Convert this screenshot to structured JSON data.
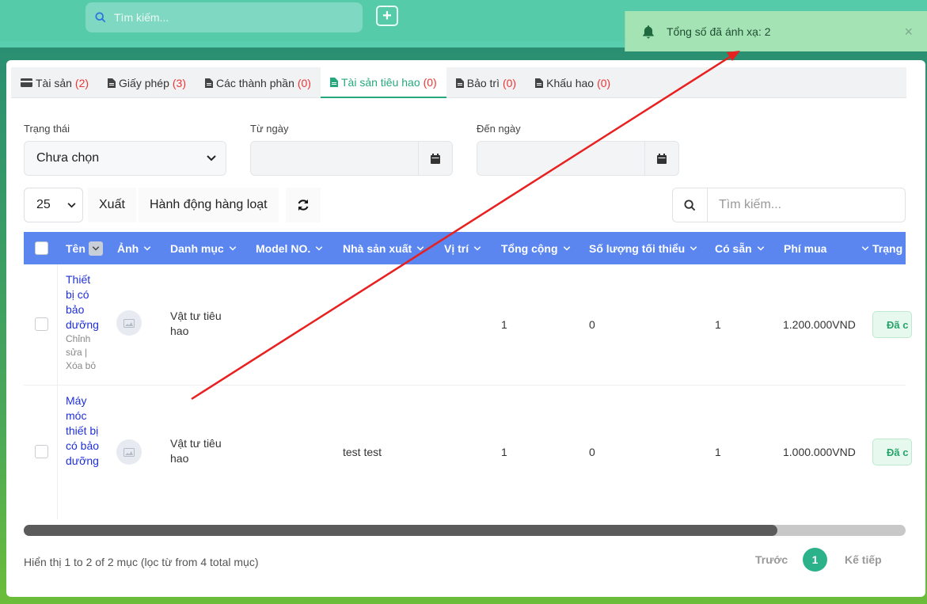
{
  "topbar": {
    "search_placeholder": "Tìm kiếm...",
    "add_label": "+"
  },
  "toast": {
    "message": "Tổng số đã ánh xạ: 2",
    "close": "×"
  },
  "tabs": [
    {
      "label": "Tài sản",
      "count": "(2)"
    },
    {
      "label": "Giấy phép",
      "count": "(3)"
    },
    {
      "label": "Các thành phần",
      "count": "(0)"
    },
    {
      "label": "Tài sản tiêu hao",
      "count": "(0)"
    },
    {
      "label": "Bảo trì",
      "count": "(0)"
    },
    {
      "label": "Khấu hao",
      "count": "(0)"
    }
  ],
  "filters": {
    "status_label": "Trạng thái",
    "status_value": "Chưa chọn",
    "from_label": "Từ ngày",
    "to_label": "Đến ngày"
  },
  "toolbar": {
    "page_size": "25",
    "export": "Xuất",
    "bulk": "Hành động hàng loạt",
    "search_placeholder": "Tìm kiếm..."
  },
  "columns": [
    "Tên",
    "Ảnh",
    "Danh mục",
    "Model NO.",
    "Nhà sản xuất",
    "Vị trí",
    "Tổng cộng",
    "Số lượng tối thiểu",
    "Có sẵn",
    "Phí mua",
    "Trạng"
  ],
  "rows": [
    {
      "name_lines": [
        "Thiết",
        "bị có",
        "bảo",
        "dưỡng"
      ],
      "actions": [
        "Chỉnh",
        "sửa |",
        "Xóa bỏ"
      ],
      "category_lines": [
        "Vật tư tiêu",
        "hao"
      ],
      "manufacturer": "",
      "total": "1",
      "min_qty": "0",
      "available": "1",
      "cost": "1.200.000VND",
      "status": "Đã c"
    },
    {
      "name_lines": [
        "Máy",
        "móc",
        "thiết bị",
        "có bảo",
        "dưỡng"
      ],
      "actions": [],
      "category_lines": [
        "Vật tư tiêu",
        "hao"
      ],
      "manufacturer": "test test",
      "total": "1",
      "min_qty": "0",
      "available": "1",
      "cost": "1.000.000VND",
      "status": "Đã c"
    }
  ],
  "footer": {
    "info": "Hiển thị 1 to 2 of 2 mục (lọc từ from 4 total mục)",
    "prev": "Trước",
    "page": "1",
    "next": "Kế tiếp"
  },
  "colors": {
    "accent": "#25a87c",
    "header": "#5b86f0",
    "toast": "#a4e4b4",
    "annotation_arrow": "#e8201f"
  }
}
